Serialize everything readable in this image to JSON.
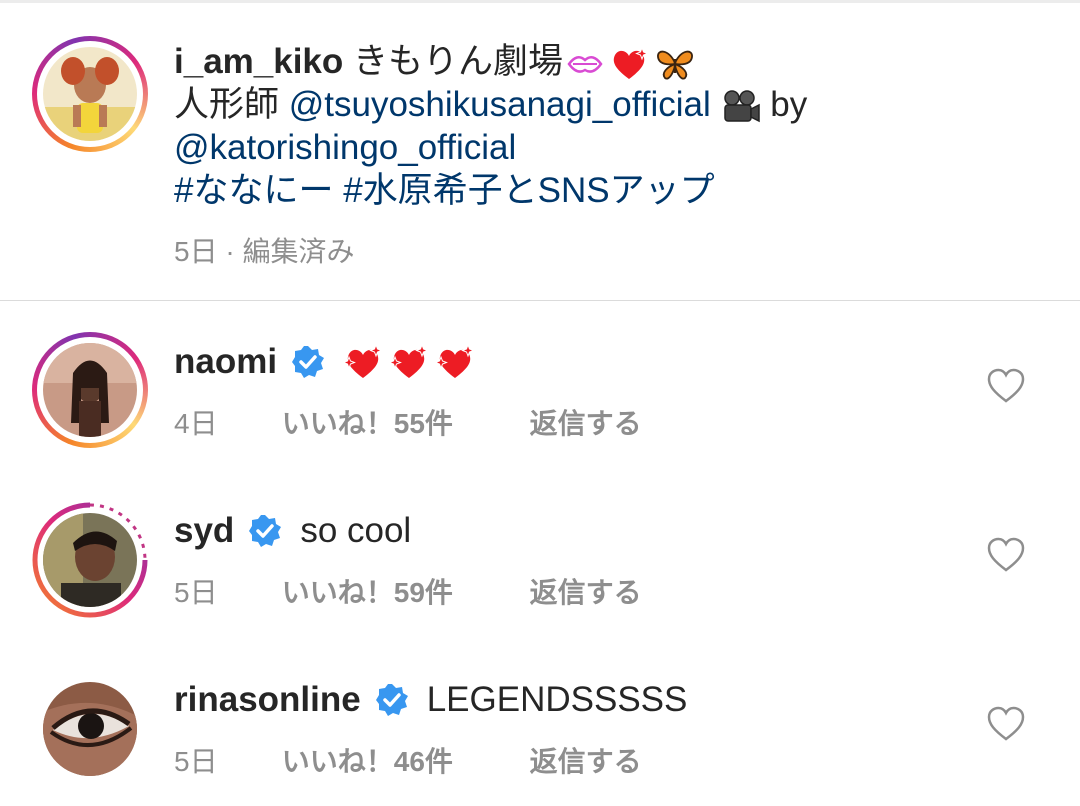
{
  "post": {
    "username": "i_am_kiko",
    "caption_text": " きもりん劇場",
    "caption_line2_prefix": "人形師 ",
    "mention1": "@tsuyoshikusanagi_official",
    "caption_line2_suffix": " by",
    "mention2": "@katorishingo_official",
    "hashtag1": "#ななにー",
    "hashtag2": "#水原希子とSNSアップ",
    "meta": "5日 · 編集済み",
    "emojis": [
      "kiss-lips",
      "sparkling-heart",
      "butterfly",
      "film-camera"
    ]
  },
  "comments": [
    {
      "username": "naomi",
      "verified": true,
      "text": "",
      "emojis": [
        "sparkling-heart",
        "sparkling-heart",
        "sparkling-heart"
      ],
      "time": "4日",
      "likes": "いいね！55件",
      "reply": "返信する"
    },
    {
      "username": "syd",
      "verified": true,
      "text": "so cool",
      "time": "5日",
      "likes": "いいね！59件",
      "reply": "返信する"
    },
    {
      "username": "rinasonline",
      "verified": true,
      "text": "LEGENDSSSSS",
      "time": "5日",
      "likes": "いいね！46件",
      "reply": "返信する"
    }
  ],
  "colors": {
    "text": "#262626",
    "link": "#00376b",
    "muted": "#8e8e8e",
    "verified": "#3897f0",
    "heart": "#ed1c24"
  }
}
